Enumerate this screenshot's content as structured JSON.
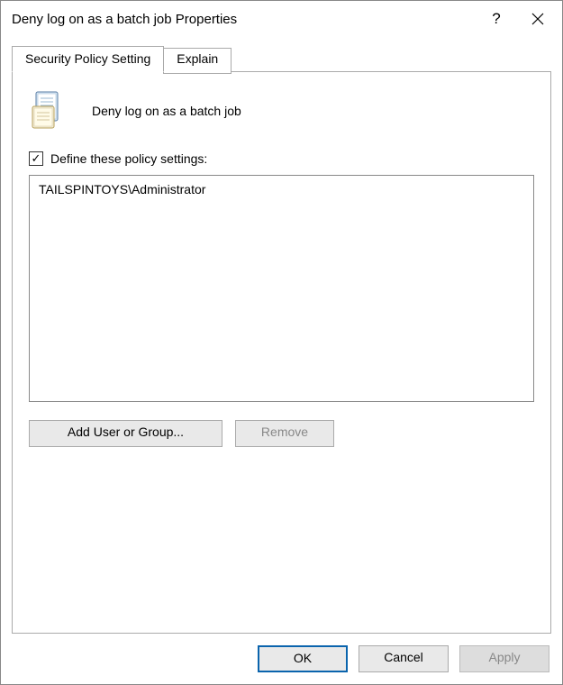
{
  "window": {
    "title": "Deny log on as a batch job Properties"
  },
  "tabs": [
    {
      "label": "Security Policy Setting",
      "active": true
    },
    {
      "label": "Explain",
      "active": false
    }
  ],
  "policy": {
    "name": "Deny log on as a batch job",
    "define_label": "Define these policy settings:",
    "define_checked": true,
    "entries": [
      "TAILSPINTOYS\\Administrator"
    ]
  },
  "buttons": {
    "add_user_or_group": "Add User or Group...",
    "remove": "Remove",
    "ok": "OK",
    "cancel": "Cancel",
    "apply": "Apply"
  }
}
